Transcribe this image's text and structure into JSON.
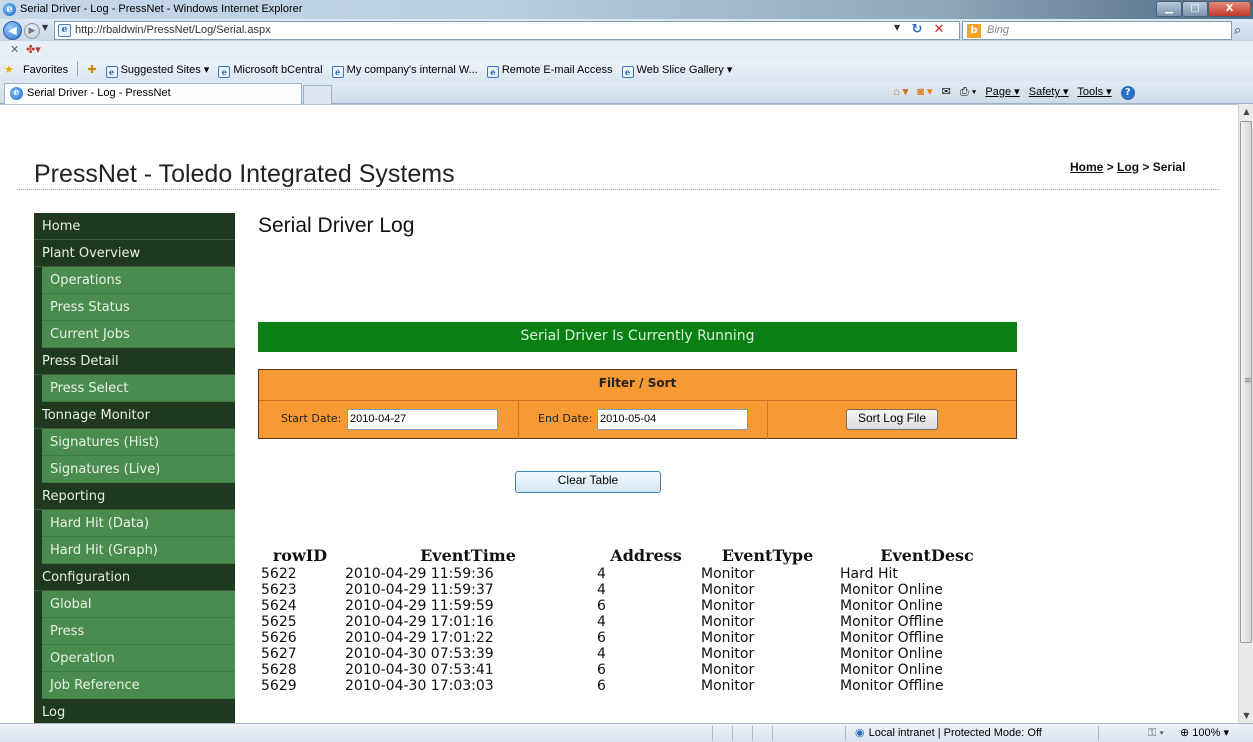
{
  "window": {
    "title": "Serial Driver - Log - PressNet - Windows Internet Explorer",
    "controls": {
      "minimize": "▁",
      "maximize": "□",
      "close": "X"
    }
  },
  "browser": {
    "url": "http://rbaldwin/PressNet/Log/Serial.aspx",
    "search_placeholder": "Bing",
    "tab_title": "Serial Driver - Log - PressNet",
    "favorites_label": "Favorites",
    "favorites": [
      "Suggested Sites ▾",
      "Microsoft bCentral",
      "My company's internal W...",
      "Remote E-mail Access",
      "Web Slice Gallery ▾"
    ],
    "command_bar": {
      "page": "Page ▾",
      "safety": "Safety ▾",
      "tools": "Tools ▾"
    },
    "status_zone": "Local intranet | Protected Mode: Off",
    "zoom": "100%"
  },
  "page": {
    "site_title": "PressNet - Toledo Integrated Systems",
    "breadcrumb": {
      "home": "Home",
      "sep": " > ",
      "log": "Log",
      "current": "Serial"
    },
    "title": "Serial Driver Log",
    "status_message": "Serial Driver Is Currently Running",
    "filter": {
      "title": "Filter / Sort",
      "start_label": "Start Date:",
      "start_value": "2010-04-27",
      "end_label": "End Date:",
      "end_value": "2010-05-04",
      "sort_button": "Sort Log File"
    },
    "clear_button": "Clear Table",
    "table": {
      "headers": [
        "rowID",
        "EventTime",
        "Address",
        "EventType",
        "EventDesc"
      ],
      "rows": [
        [
          "5622",
          "2010-04-29 11:59:36",
          "4",
          "Monitor",
          "Hard Hit"
        ],
        [
          "5623",
          "2010-04-29 11:59:37",
          "4",
          "Monitor",
          "Monitor Online"
        ],
        [
          "5624",
          "2010-04-29 11:59:59",
          "6",
          "Monitor",
          "Monitor Online"
        ],
        [
          "5625",
          "2010-04-29 17:01:16",
          "4",
          "Monitor",
          "Monitor Offline"
        ],
        [
          "5626",
          "2010-04-29 17:01:22",
          "6",
          "Monitor",
          "Monitor Offline"
        ],
        [
          "5627",
          "2010-04-30 07:53:39",
          "4",
          "Monitor",
          "Monitor Online"
        ],
        [
          "5628",
          "2010-04-30 07:53:41",
          "6",
          "Monitor",
          "Monitor Online"
        ],
        [
          "5629",
          "2010-04-30 17:03:03",
          "6",
          "Monitor",
          "Monitor Offline"
        ]
      ]
    }
  },
  "sidebar": {
    "sections": [
      {
        "label": "Home",
        "children": []
      },
      {
        "label": "Plant Overview",
        "children": [
          "Operations",
          "Press Status",
          "Current Jobs"
        ]
      },
      {
        "label": "Press Detail",
        "children": [
          "Press Select"
        ]
      },
      {
        "label": "Tonnage Monitor",
        "children": [
          "Signatures (Hist)",
          "Signatures (Live)"
        ]
      },
      {
        "label": "Reporting",
        "children": [
          "Hard Hit (Data)",
          "Hard Hit (Graph)"
        ]
      },
      {
        "label": "Configuration",
        "children": [
          "Global",
          "Press",
          "Operation",
          "Job Reference"
        ]
      },
      {
        "label": "Log",
        "children": []
      }
    ]
  }
}
